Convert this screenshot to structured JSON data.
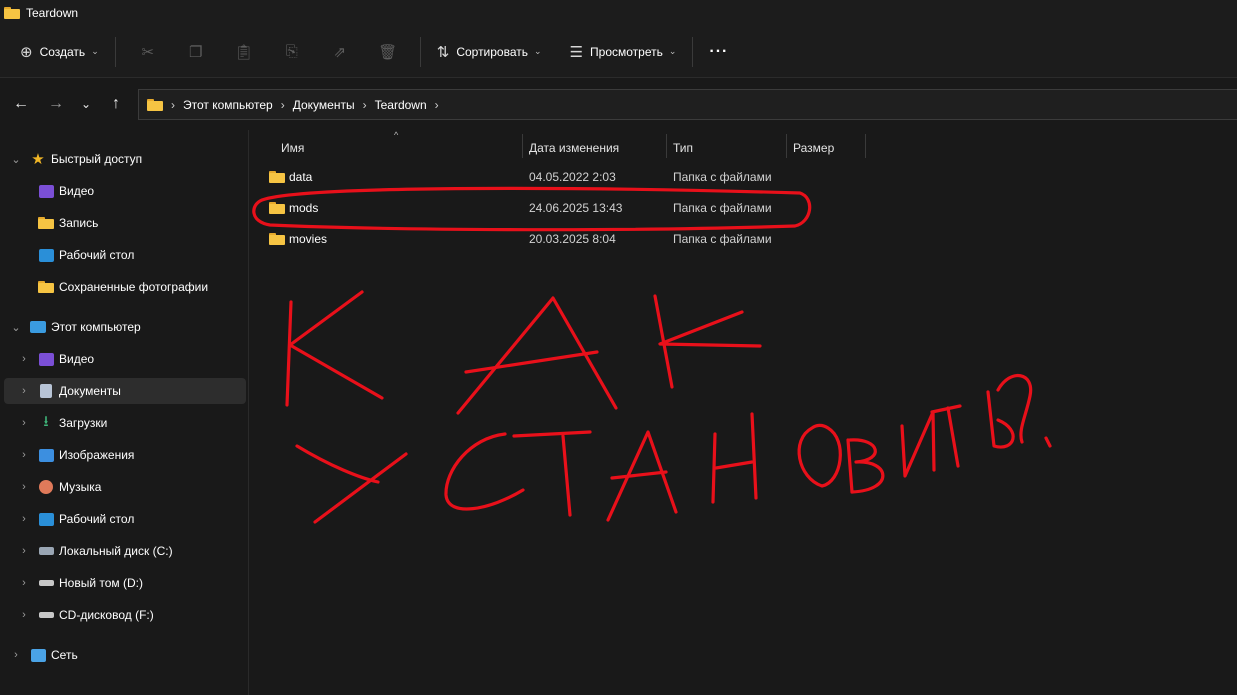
{
  "window": {
    "title": "Teardown",
    "title_icon": "folder-icon"
  },
  "commandbar": {
    "create_label": "Создать",
    "create_icon": "plus-circle-icon",
    "actions": [
      "cut-icon",
      "copy-icon",
      "paste-icon",
      "rename-icon",
      "share-icon",
      "delete-icon"
    ],
    "sort_label": "Сортировать",
    "sort_icon": "sort-icon",
    "view_label": "Просмотреть",
    "view_icon": "view-icon",
    "more_label": "···"
  },
  "navigation": {
    "back_icon": "arrow-left-icon",
    "forward_icon": "arrow-right-icon",
    "recent_icon": "chevron-down-icon",
    "up_icon": "arrow-up-icon",
    "breadcrumb": [
      "Этот компьютер",
      "Документы",
      "Teardown"
    ]
  },
  "sidebar": {
    "items": [
      {
        "label": "Быстрый доступ",
        "icon": "star-icon",
        "level": 0,
        "expanded": true
      },
      {
        "label": "Видео",
        "icon": "video-folder-icon",
        "level": 1
      },
      {
        "label": "Запись",
        "icon": "folder-icon",
        "level": 1
      },
      {
        "label": "Рабочий стол",
        "icon": "desktop-icon",
        "level": 1
      },
      {
        "label": "Сохраненные фотографии",
        "icon": "folder-icon",
        "level": 1
      },
      {
        "label": "Этот компьютер",
        "icon": "computer-icon",
        "level": 0,
        "expanded": true
      },
      {
        "label": "Видео",
        "icon": "video-folder-icon",
        "level": 1
      },
      {
        "label": "Документы",
        "icon": "documents-icon",
        "level": 1,
        "selected": true
      },
      {
        "label": "Загрузки",
        "icon": "download-icon",
        "level": 1
      },
      {
        "label": "Изображения",
        "icon": "pictures-icon",
        "level": 1
      },
      {
        "label": "Музыка",
        "icon": "music-icon",
        "level": 1
      },
      {
        "label": "Рабочий стол",
        "icon": "desktop-icon",
        "level": 1
      },
      {
        "label": "Локальный диск (C:)",
        "icon": "drive-c-icon",
        "level": 1
      },
      {
        "label": "Новый том (D:)",
        "icon": "drive-icon",
        "level": 1
      },
      {
        "label": "CD-дисковод (F:)",
        "icon": "cd-drive-icon",
        "level": 1
      },
      {
        "label": "Сеть",
        "icon": "network-icon",
        "level": 0
      }
    ]
  },
  "filelist": {
    "columns": {
      "name": "Имя",
      "modified": "Дата изменения",
      "type": "Тип",
      "size": "Размер"
    },
    "sorted_by": "name",
    "rows": [
      {
        "name": "data",
        "modified": "04.05.2022 2:03",
        "type": "Папка с файлами"
      },
      {
        "name": "mods",
        "modified": "24.06.2025 13:43",
        "type": "Папка с файлами"
      },
      {
        "name": "movies",
        "modified": "20.03.2025 8:04",
        "type": "Папка с файлами"
      }
    ]
  },
  "annotation": {
    "color": "#e8101a",
    "handwriting_line1": "КАК",
    "handwriting_line2": "УСТАНОВИТЬ?",
    "circled_row": "mods"
  },
  "colors": {
    "background": "#191919",
    "folder": "#f6c443",
    "selection": "#2d2d2d",
    "star": "#f2b726"
  }
}
